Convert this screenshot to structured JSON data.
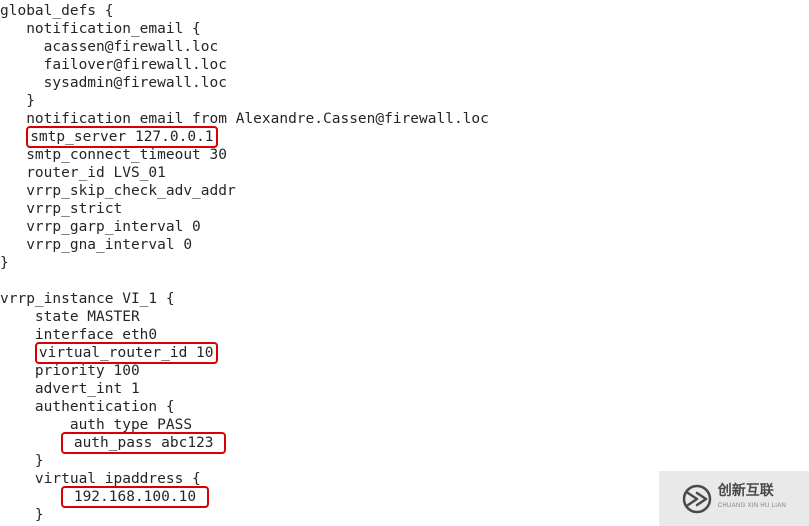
{
  "cfg": {
    "l1": "global_defs {",
    "l2": "   notification_email {",
    "l3": "     acassen@firewall.loc",
    "l4": "     failover@firewall.loc",
    "l5": "     sysadmin@firewall.loc",
    "l6": "   }",
    "l7": "   notification_email_from Alexandre.Cassen@firewall.loc",
    "l8p": "   ",
    "l8h": "smtp_server 127.0.0.1",
    "l9": "   smtp_connect_timeout 30",
    "l10": "   router_id LVS_01",
    "l11": "   vrrp_skip_check_adv_addr",
    "l12": "   vrrp_strict",
    "l13": "   vrrp_garp_interval 0",
    "l14": "   vrrp_gna_interval 0",
    "l15": "}",
    "l16": "",
    "l17": "vrrp_instance VI_1 {",
    "l18": "    state MASTER",
    "l19": "    interface eth0",
    "l20p": "    ",
    "l20h": "virtual_router_id 10",
    "l21": "    priority 100",
    "l22": "    advert_int 1",
    "l23": "    authentication {",
    "l24": "        auth_type PASS",
    "l25p": "       ",
    "l25h": " auth_pass abc123 ",
    "l26": "    }",
    "l27": "    virtual_ipaddress {",
    "l28p": "       ",
    "l28h": " 192.168.100.10 ",
    "l29": "    }"
  },
  "watermark": {
    "brand": "创新互联",
    "sub": "CHUANG XIN HU LIAN"
  }
}
